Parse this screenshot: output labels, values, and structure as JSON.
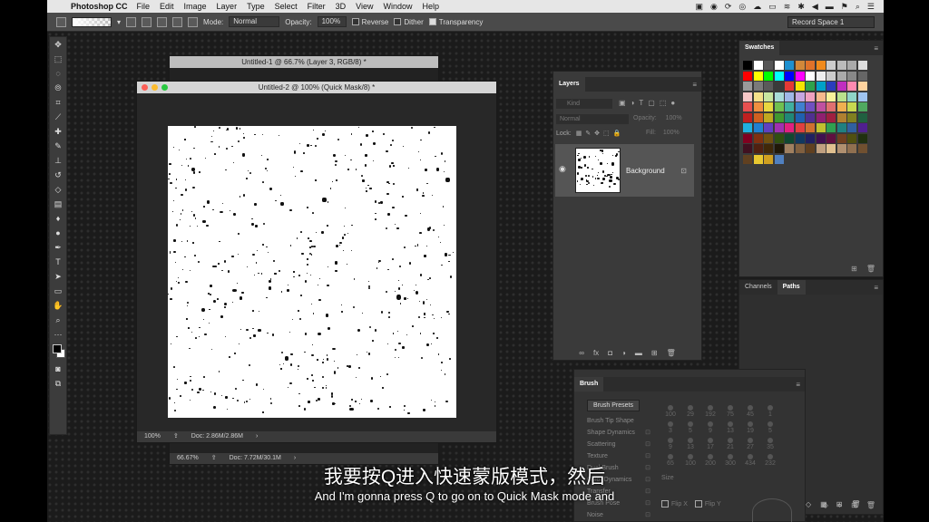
{
  "menubar": {
    "app_name": "Photoshop CC",
    "items": [
      "File",
      "Edit",
      "Image",
      "Layer",
      "Type",
      "Select",
      "Filter",
      "3D",
      "View",
      "Window",
      "Help"
    ]
  },
  "options": {
    "mode_label": "Mode:",
    "mode_value": "Normal",
    "opacity_label": "Opacity:",
    "opacity_value": "100%",
    "reverse_label": "Reverse",
    "dither_label": "Dither",
    "transparency_label": "Transparency",
    "record_space": "Record Space 1"
  },
  "doc_back": {
    "title": "Untitled-1 @ 66.7% (Layer 3, RGB/8) *",
    "zoom": "66.67%",
    "doc_info": "Doc: 7.72M/30.1M"
  },
  "doc_front": {
    "title": "Untitled-2 @ 100% (Quick Mask/8) *",
    "zoom": "100%",
    "doc_info": "Doc: 2.86M/2.86M"
  },
  "layers_panel": {
    "tab": "Layers",
    "kind": "Kind",
    "blend": "Normal",
    "opacity_label": "Opacity:",
    "opacity_value": "100%",
    "lock_label": "Lock:",
    "fill_label": "Fill:",
    "fill_value": "100%",
    "layer_name": "Background"
  },
  "swatches_panel": {
    "tab": "Swatches",
    "colors": [
      "#000000",
      "#ffffff",
      "#555555",
      "#ffffff",
      "#1e90d0",
      "#d2883a",
      "#e0722a",
      "#f08a1c",
      "#cccccc",
      "#bbbbbb",
      "#aaaaaa",
      "#dddddd",
      "#ff0000",
      "#ffff00",
      "#00ff00",
      "#00ffff",
      "#0000ff",
      "#ff00ff",
      "#ffffff",
      "#eeeeee",
      "#cccccc",
      "#aaaaaa",
      "#888888",
      "#666666",
      "#9a9a9a",
      "#7a7a7a",
      "#5a5a5a",
      "#3a3a3a",
      "#e53935",
      "#f5e400",
      "#2ea24a",
      "#00a0c8",
      "#2a3dbd",
      "#c02ec0",
      "#ff8ab0",
      "#ffd39e",
      "#f7c7c7",
      "#f4e08a",
      "#c8e6a0",
      "#a8dcd9",
      "#9fb8e8",
      "#c6a6e0",
      "#f0a0c0",
      "#f7b98d",
      "#f9f29a",
      "#b9e28c",
      "#8fd4c8",
      "#a0c4f0",
      "#e85050",
      "#f09040",
      "#e8d840",
      "#70c050",
      "#40b0a0",
      "#4080d0",
      "#7050c0",
      "#c050a0",
      "#e07070",
      "#f0b050",
      "#c8d850",
      "#50a860",
      "#c02020",
      "#d06020",
      "#c0a820",
      "#409830",
      "#208878",
      "#2060b0",
      "#503090",
      "#902070",
      "#a02040",
      "#b08030",
      "#808020",
      "#206040",
      "#20b0e0",
      "#2080d0",
      "#6040c0",
      "#a030b0",
      "#e02080",
      "#e04040",
      "#d07030",
      "#c0c030",
      "#30a050",
      "#208080",
      "#3060a0",
      "#502090",
      "#800020",
      "#803010",
      "#705010",
      "#305010",
      "#104830",
      "#103860",
      "#202060",
      "#401050",
      "#601040",
      "#704020",
      "#505010",
      "#203010",
      "#401020",
      "#502010",
      "#402808",
      "#201808",
      "#a08060",
      "#806040",
      "#604020",
      "#c0a080",
      "#e0c090",
      "#b09070",
      "#907050",
      "#705030",
      "#604020",
      "#e8c830",
      "#d0a020",
      "#5080c0"
    ]
  },
  "channels_panel": {
    "tab_channels": "Channels",
    "tab_paths": "Paths"
  },
  "brush_panel": {
    "tab": "Brush",
    "presets_button": "Brush Presets",
    "options": [
      "Brush Tip Shape",
      "Shape Dynamics",
      "Scattering",
      "Texture",
      "Dual Brush",
      "Color Dynamics",
      "Transfer",
      "Brush Pose",
      "Noise"
    ],
    "sizes": [
      "100",
      "29",
      "192",
      "75",
      "45",
      "1",
      "3",
      "5",
      "9",
      "13",
      "19",
      "5",
      "9",
      "13",
      "17",
      "21",
      "27",
      "35",
      "65",
      "100",
      "200",
      "300",
      "434",
      "232"
    ],
    "size_label": "Size",
    "flip_x": "Flip X",
    "flip_y": "Flip Y"
  },
  "subtitles": {
    "cn": "我要按Q进入快速蒙版模式，然后",
    "en": "And I'm gonna press Q to go on to Quick Mask mode and"
  }
}
